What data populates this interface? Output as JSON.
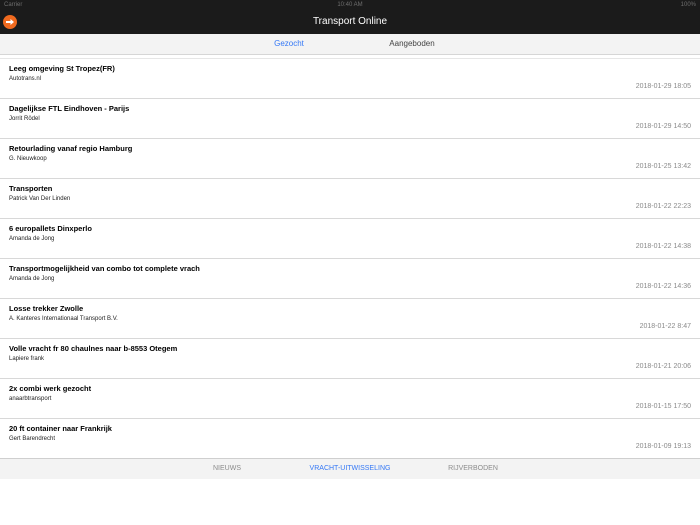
{
  "status_bar": {
    "carrier": "Carrier",
    "time": "10:40 AM",
    "battery": "100%"
  },
  "nav": {
    "title": "Transport Online",
    "menu_icon": "arrow-right-icon"
  },
  "segments": [
    {
      "label": "Gezocht",
      "selected": true
    },
    {
      "label": "Aangeboden",
      "selected": false
    }
  ],
  "list": [
    {
      "title": "Leeg omgeving St Tropez(FR)",
      "author": "Autotrans.nl",
      "date": "2018-01-29 18:05"
    },
    {
      "title": "Dagelijkse FTL Eindhoven - Parijs",
      "author": "Jorrit Rödel",
      "date": "2018-01-29 14:50"
    },
    {
      "title": "Retourlading vanaf regio Hamburg",
      "author": "G. Nieuwkoop",
      "date": "2018-01-25 13:42"
    },
    {
      "title": "Transporten",
      "author": "Patrick Van Der Linden",
      "date": "2018-01-22 22:23"
    },
    {
      "title": "6 europallets Dinxperlo",
      "author": "Amanda de Jong",
      "date": "2018-01-22 14:38"
    },
    {
      "title": "Transportmogelijkheid van combo tot complete vrach",
      "author": "Amanda de Jong",
      "date": "2018-01-22 14:36"
    },
    {
      "title": "Losse trekker Zwolle",
      "author": "A. Kanteres Internationaal Transport B.V.",
      "date": "2018-01-22 8:47"
    },
    {
      "title": "Volle vracht fr 80 chaulnes naar b-8553 Otegem",
      "author": "Lapiere frank",
      "date": "2018-01-21 20:06"
    },
    {
      "title": "2x combi werk gezocht",
      "author": "anaarbtransport",
      "date": "2018-01-15 17:50"
    },
    {
      "title": "20 ft container naar Frankrijk",
      "author": "Gert Barendrecht",
      "date": "2018-01-09 19:13"
    }
  ],
  "tabs": [
    {
      "label": "NIEUWS",
      "selected": false
    },
    {
      "label": "VRACHT-UITWISSELING",
      "selected": true
    },
    {
      "label": "RIJVERBODEN",
      "selected": false
    }
  ],
  "colors": {
    "accent": "#3478f6",
    "icon_orange": "#f06a1f",
    "navbar": "#1b1b1b"
  }
}
